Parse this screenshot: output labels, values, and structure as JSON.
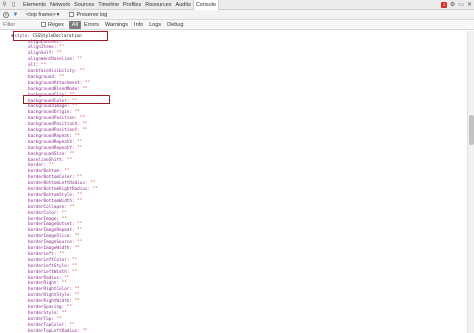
{
  "tabbar": {
    "tabs": [
      {
        "label": "Elements",
        "active": false
      },
      {
        "label": "Network",
        "active": false
      },
      {
        "label": "Sources",
        "active": false
      },
      {
        "label": "Timeline",
        "active": false
      },
      {
        "label": "Profiles",
        "active": false
      },
      {
        "label": "Resources",
        "active": false
      },
      {
        "label": "Audits",
        "active": false
      },
      {
        "label": "Console",
        "active": true
      }
    ],
    "error_count": "1"
  },
  "toolbar": {
    "frame_selector": "<top frame>",
    "preserve_log_label": "Preserve log"
  },
  "filter": {
    "placeholder": "Filter",
    "regex_label": "Regex",
    "levels": [
      "All",
      "Errors",
      "Warnings",
      "Info",
      "Logs",
      "Debug"
    ],
    "active_level": "All"
  },
  "console": {
    "root": {
      "key": "style",
      "value": "CSSStyleDeclaration"
    },
    "properties": [
      {
        "key": "alignContent",
        "value": "\"\""
      },
      {
        "key": "alignItems",
        "value": "\"\""
      },
      {
        "key": "alignSelf",
        "value": "\"\""
      },
      {
        "key": "alignmentBaseline",
        "value": "\"\""
      },
      {
        "key": "all",
        "value": "\"\""
      },
      {
        "key": "backfaceVisibility",
        "value": "\"\""
      },
      {
        "key": "background",
        "value": "\"\""
      },
      {
        "key": "backgroundAttachment",
        "value": "\"\""
      },
      {
        "key": "backgroundBlendMode",
        "value": "\"\""
      },
      {
        "key": "backgroundClip",
        "value": "\"\""
      },
      {
        "key": "backgroundColor",
        "value": "\"\""
      },
      {
        "key": "backgroundImage",
        "value": "\"\""
      },
      {
        "key": "backgroundOrigin",
        "value": "\"\""
      },
      {
        "key": "backgroundPosition",
        "value": "\"\""
      },
      {
        "key": "backgroundPositionX",
        "value": "\"\""
      },
      {
        "key": "backgroundPositionY",
        "value": "\"\""
      },
      {
        "key": "backgroundRepeat",
        "value": "\"\""
      },
      {
        "key": "backgroundRepeatX",
        "value": "\"\""
      },
      {
        "key": "backgroundRepeatY",
        "value": "\"\""
      },
      {
        "key": "backgroundSize",
        "value": "\"\""
      },
      {
        "key": "baselineShift",
        "value": "\"\""
      },
      {
        "key": "border",
        "value": "\"\""
      },
      {
        "key": "borderBottom",
        "value": "\"\""
      },
      {
        "key": "borderBottomColor",
        "value": "\"\""
      },
      {
        "key": "borderBottomLeftRadius",
        "value": "\"\""
      },
      {
        "key": "borderBottomRightRadius",
        "value": "\"\""
      },
      {
        "key": "borderBottomStyle",
        "value": "\"\""
      },
      {
        "key": "borderBottomWidth",
        "value": "\"\""
      },
      {
        "key": "borderCollapse",
        "value": "\"\""
      },
      {
        "key": "borderColor",
        "value": "\"\""
      },
      {
        "key": "borderImage",
        "value": "\"\""
      },
      {
        "key": "borderImageOutset",
        "value": "\"\""
      },
      {
        "key": "borderImageRepeat",
        "value": "\"\""
      },
      {
        "key": "borderImageSlice",
        "value": "\"\""
      },
      {
        "key": "borderImageSource",
        "value": "\"\""
      },
      {
        "key": "borderImageWidth",
        "value": "\"\""
      },
      {
        "key": "borderLeft",
        "value": "\"\""
      },
      {
        "key": "borderLeftColor",
        "value": "\"\""
      },
      {
        "key": "borderLeftStyle",
        "value": "\"\""
      },
      {
        "key": "borderLeftWidth",
        "value": "\"\""
      },
      {
        "key": "borderRadius",
        "value": "\"\""
      },
      {
        "key": "borderRight",
        "value": "\"\""
      },
      {
        "key": "borderRightColor",
        "value": "\"\""
      },
      {
        "key": "borderRightStyle",
        "value": "\"\""
      },
      {
        "key": "borderRightWidth",
        "value": "\"\""
      },
      {
        "key": "borderSpacing",
        "value": "\"\""
      },
      {
        "key": "borderStyle",
        "value": "\"\""
      },
      {
        "key": "borderTop",
        "value": "\"\""
      },
      {
        "key": "borderTopColor",
        "value": "\"\""
      },
      {
        "key": "borderTopLeftRadius",
        "value": "\"\""
      }
    ],
    "highlighted_property": "backgroundColor"
  },
  "colors": {
    "highlight": "#9c1b22",
    "key": "#8b2a8b",
    "string": "#c41a16",
    "error_badge": "#d93025"
  }
}
